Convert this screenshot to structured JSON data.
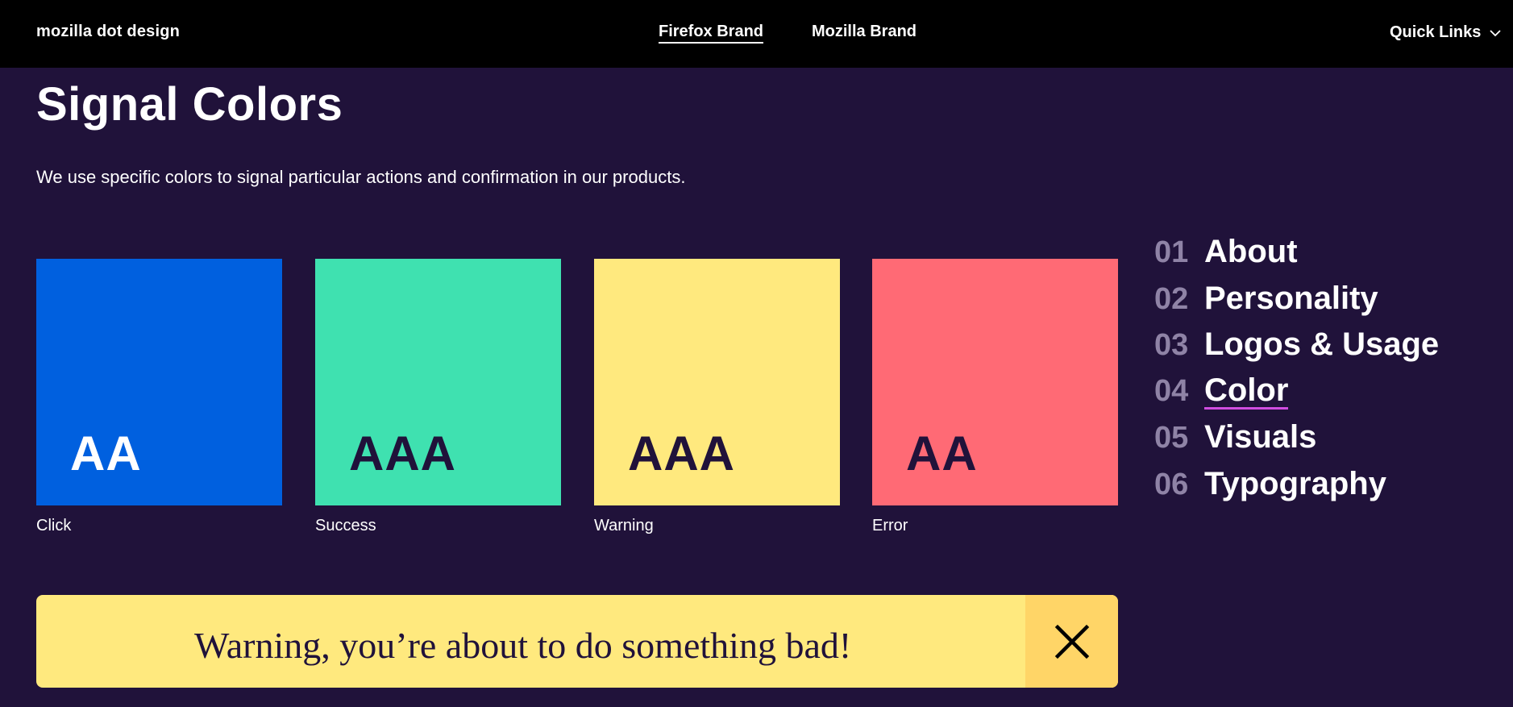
{
  "header": {
    "brand": "mozilla dot design",
    "nav": [
      {
        "label": "Firefox Brand",
        "active": true
      },
      {
        "label": "Mozilla Brand",
        "active": false
      }
    ],
    "quick_links": "Quick Links"
  },
  "main": {
    "title": "Signal Colors",
    "intro": "We use specific colors to signal particular actions and confirmation in our products.",
    "swatches": [
      {
        "rating": "AA",
        "label": "Click",
        "color": "#0060df",
        "text_color": "#ffffff"
      },
      {
        "rating": "AAA",
        "label": "Success",
        "color": "#3fe1b0",
        "text_color": "#20123a"
      },
      {
        "rating": "AAA",
        "label": "Warning",
        "color": "#ffe97e",
        "text_color": "#20123a"
      },
      {
        "rating": "AA",
        "label": "Error",
        "color": "#ff6a75",
        "text_color": "#20123a"
      }
    ],
    "alert": {
      "message": "Warning, you’re about to do something bad!",
      "close_icon": "close-icon"
    }
  },
  "toc": {
    "items": [
      {
        "num": "01",
        "label": "About"
      },
      {
        "num": "02",
        "label": "Personality"
      },
      {
        "num": "03",
        "label": "Logos & Usage"
      },
      {
        "num": "04",
        "label": "Color",
        "active": true
      },
      {
        "num": "05",
        "label": "Visuals"
      },
      {
        "num": "06",
        "label": "Typography"
      }
    ]
  },
  "colors": {
    "background": "#20123a",
    "topbar": "#000000",
    "toc_number": "#8f83a6",
    "active_underline": "#d04de0",
    "alert_close_bg": "#ffd567"
  }
}
